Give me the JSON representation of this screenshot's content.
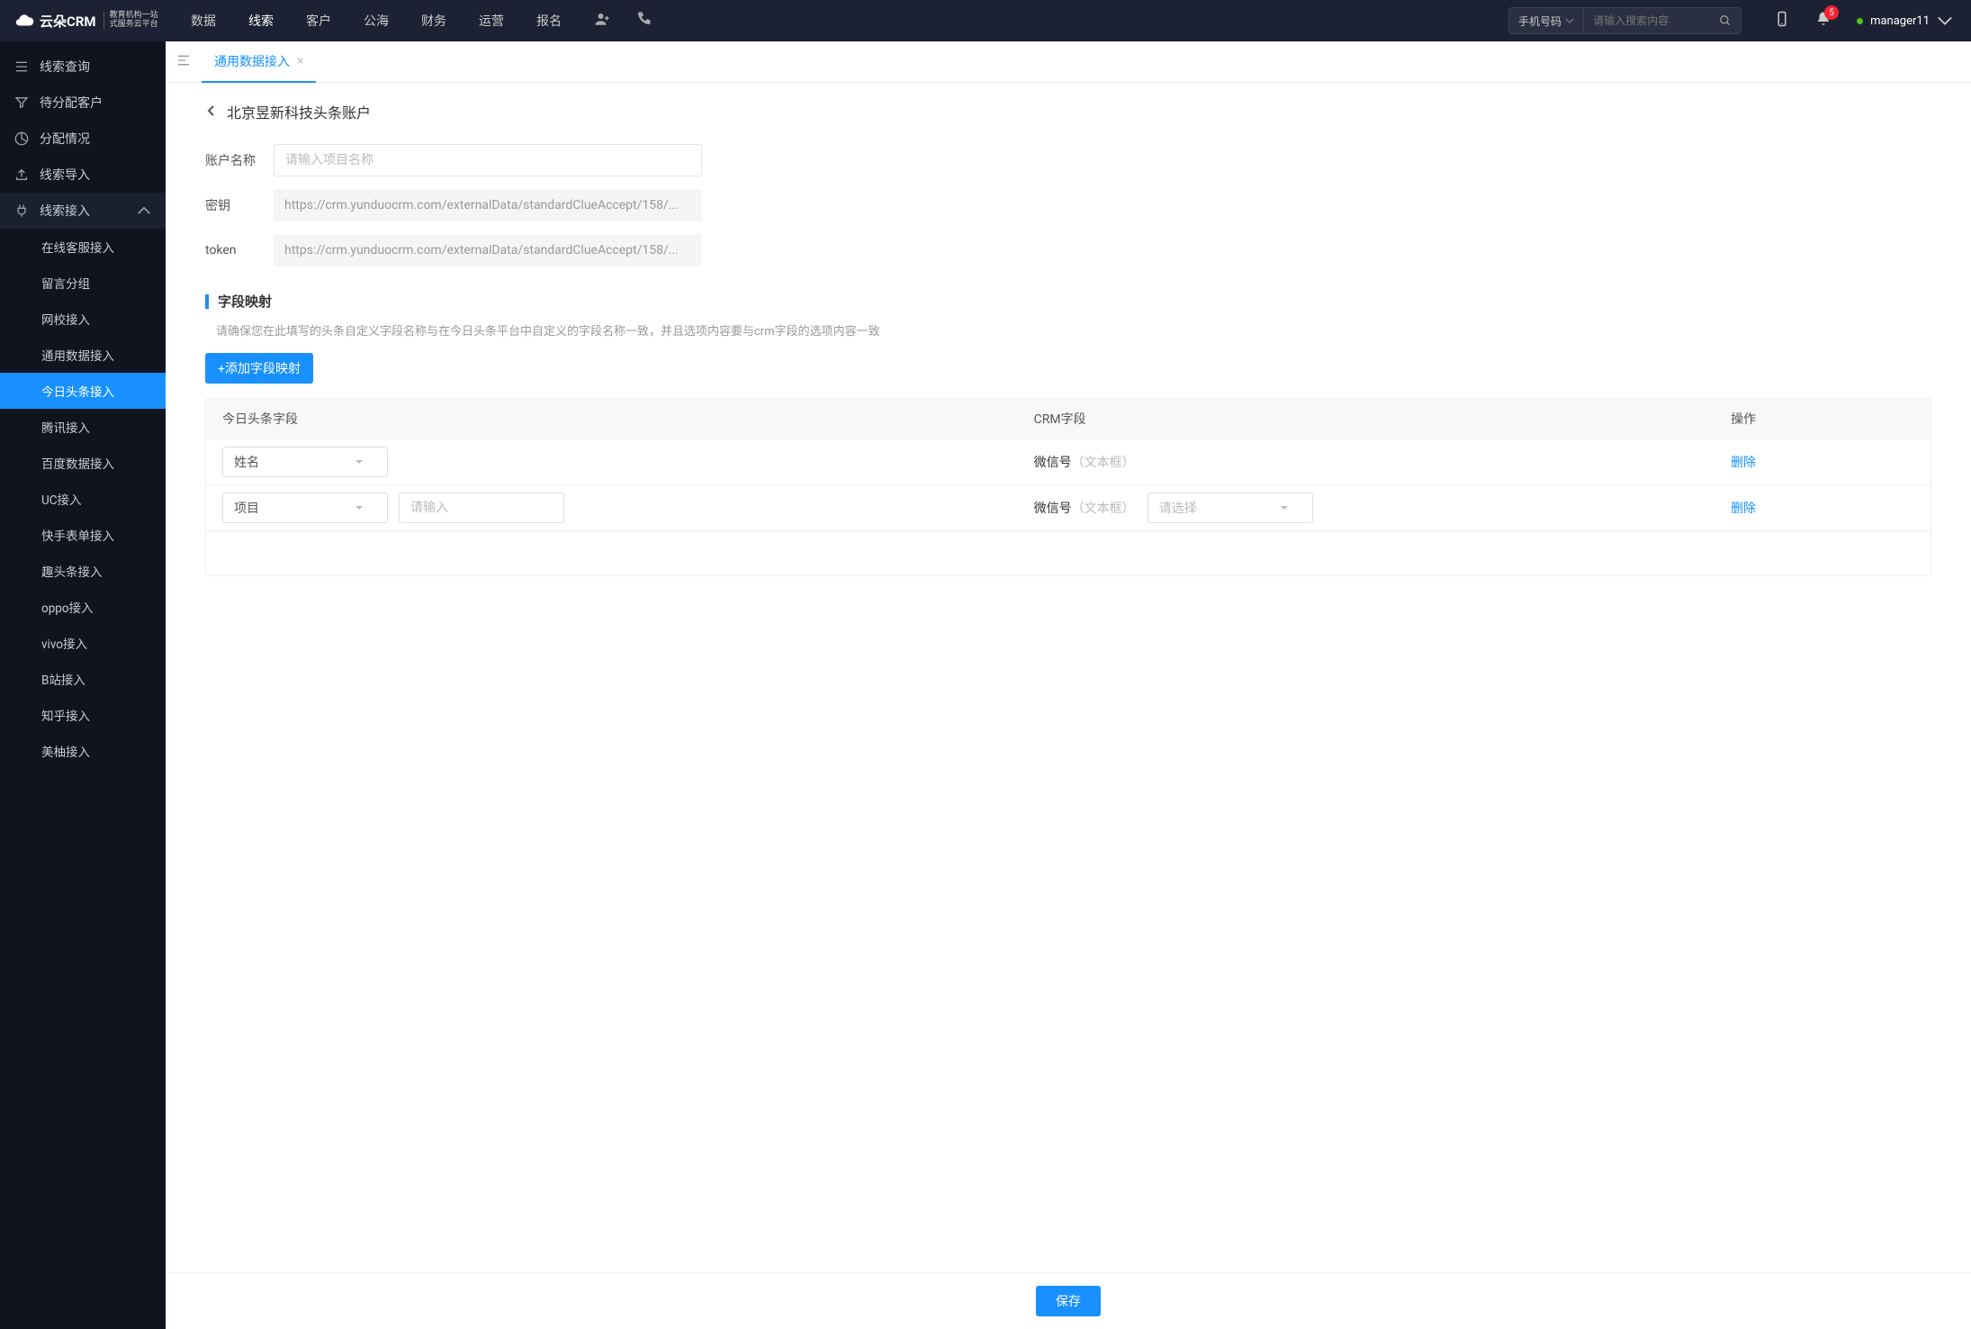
{
  "topnav": {
    "logo_brand": "云朵CRM",
    "logo_sub1": "教育机构一站",
    "logo_sub2": "式服务云平台",
    "items": [
      "数据",
      "线索",
      "客户",
      "公海",
      "财务",
      "运营",
      "报名"
    ],
    "active_index": 1,
    "search_type": "手机号码",
    "search_placeholder": "请输入搜索内容",
    "badge_count": "5",
    "username": "manager11"
  },
  "sidebar": {
    "items": [
      {
        "label": "线索查询"
      },
      {
        "label": "待分配客户"
      },
      {
        "label": "分配情况"
      },
      {
        "label": "线索导入"
      }
    ],
    "group_label": "线索接入",
    "sub_items": [
      "在线客服接入",
      "留言分组",
      "网校接入",
      "通用数据接入",
      "今日头条接入",
      "腾讯接入",
      "百度数据接入",
      "UC接入",
      "快手表单接入",
      "趣头条接入",
      "oppo接入",
      "vivo接入",
      "B站接入",
      "知乎接入",
      "美柚接入"
    ],
    "active_sub_index": 4
  },
  "tabs": {
    "current": "通用数据接入"
  },
  "page": {
    "title": "北京昱新科技头条账户",
    "form": {
      "acct_label": "账户名称",
      "acct_placeholder": "请输入项目名称",
      "secret_label": "密钥",
      "secret_value": "https://crm.yunduocrm.com/externalData/standardClueAccept/158/...",
      "token_label": "token",
      "token_value": "https://crm.yunduocrm.com/externalData/standardClueAccept/158/..."
    },
    "mapping": {
      "heading": "字段映射",
      "desc": "请确保您在此填写的头条自定义字段名称与在今日头条平台中自定义的字段名称一致，并且选项内容要与crm字段的选项内容一致",
      "add_btn": "+添加字段映射",
      "cols": {
        "c1": "今日头条字段",
        "c2": "CRM字段",
        "c3": "操作"
      },
      "rows": [
        {
          "tt_field": "姓名",
          "tt_input": null,
          "crm_name": "微信号",
          "crm_type": "（文本框）",
          "crm_select": null,
          "op": "删除"
        },
        {
          "tt_field": "项目",
          "tt_input_ph": "请输入",
          "crm_name": "微信号",
          "crm_type": "（文本框）",
          "crm_select_ph": "请选择",
          "op": "删除"
        }
      ]
    },
    "save_btn": "保存"
  }
}
